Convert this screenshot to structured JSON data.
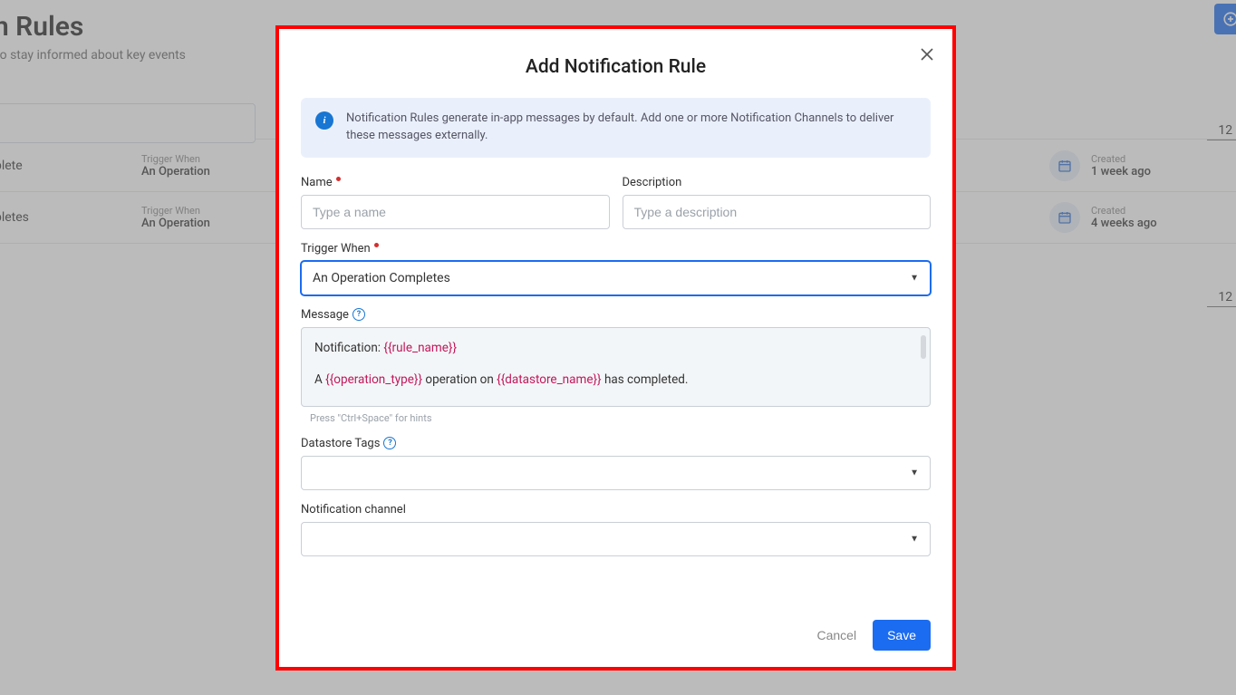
{
  "background": {
    "title_fragment": "ation Rules",
    "subtitle_fragment": "on rules to stay informed about key events",
    "top_button_icon": "plus-circle",
    "page_size_1": "12",
    "page_size_2": "12",
    "rows": [
      {
        "name_fragment": "ion Complete",
        "trigger_label": "Trigger When",
        "trigger_value_fragment": "An Operation",
        "created_label": "Created",
        "created_value": "1 week ago"
      },
      {
        "name_fragment": "ion Completes",
        "trigger_label": "Trigger When",
        "trigger_value_fragment": "An Operation",
        "created_label": "Created",
        "created_value": "4 weeks ago"
      }
    ]
  },
  "modal": {
    "title": "Add Notification Rule",
    "info": "Notification Rules generate in-app messages by default. Add one or more Notification Channels to deliver these messages externally.",
    "name": {
      "label": "Name",
      "placeholder": "Type a name",
      "value": ""
    },
    "description": {
      "label": "Description",
      "placeholder": "Type a description",
      "value": ""
    },
    "trigger": {
      "label": "Trigger When",
      "selected": "An Operation Completes"
    },
    "message": {
      "label": "Message",
      "line1_prefix": "Notification: ",
      "var_rule": "{{rule_name}}",
      "line2_a": "A ",
      "var_op": "{{operation_type}}",
      "line2_b": " operation on ",
      "var_ds": "{{datastore_name}}",
      "line2_c": " has completed.",
      "hint": "Press \"Ctrl+Space\" for hints"
    },
    "tags": {
      "label": "Datastore Tags",
      "selected": ""
    },
    "channel": {
      "label": "Notification channel",
      "selected": ""
    },
    "actions": {
      "cancel": "Cancel",
      "save": "Save"
    }
  }
}
